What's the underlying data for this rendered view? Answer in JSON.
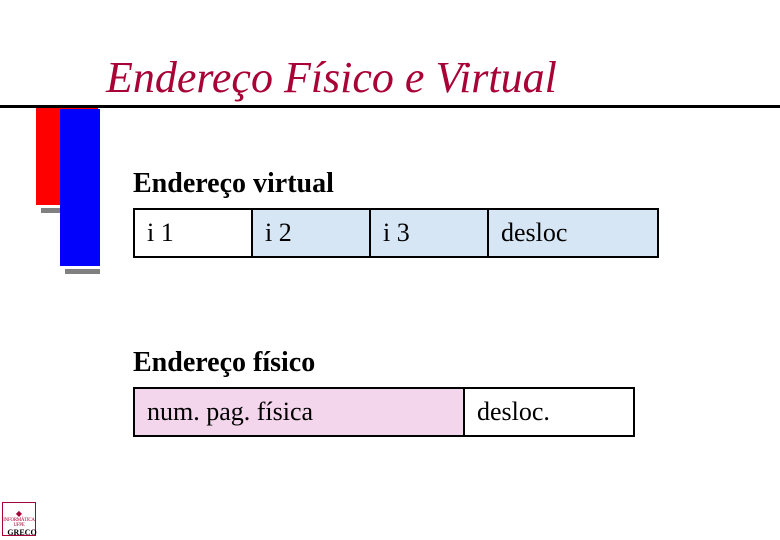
{
  "title": "Endereço Físico e Virtual",
  "virtual": {
    "heading": "Endereço virtual",
    "cells": {
      "c1": "i 1",
      "c2": "i 2",
      "c3": "i 3",
      "c4": "desloc"
    }
  },
  "physical": {
    "heading": "Endereço  físico",
    "cells": {
      "c1": "num. pag. física",
      "c2": "desloc."
    }
  },
  "footer": {
    "greco": "GRECO"
  }
}
